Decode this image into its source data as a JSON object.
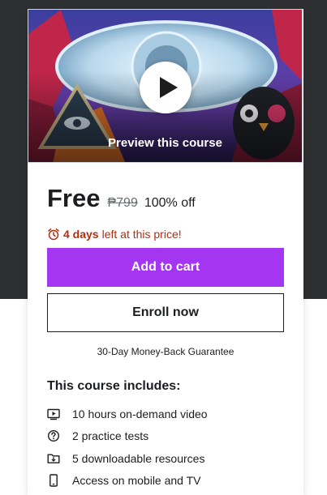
{
  "preview": {
    "label": "Preview this course",
    "play_icon": "play-icon"
  },
  "pricing": {
    "current": "Free",
    "original": "₱799",
    "discount": "100% off",
    "timer_icon": "alarm-clock-icon",
    "timer_bold": "4 days",
    "timer_rest": "left at this price!"
  },
  "actions": {
    "add_to_cart": "Add to cart",
    "enroll_now": "Enroll now"
  },
  "guarantee": "30-Day Money-Back Guarantee",
  "includes": {
    "title": "This course includes:",
    "items": [
      {
        "icon": "video-icon",
        "label": "10 hours on-demand video"
      },
      {
        "icon": "question-circle-icon",
        "label": "2 practice tests"
      },
      {
        "icon": "folder-download-icon",
        "label": "5 downloadable resources"
      },
      {
        "icon": "mobile-icon",
        "label": "Access on mobile and TV"
      }
    ]
  },
  "colors": {
    "accent": "#a435f0",
    "dark_band": "#2d2f31",
    "timer": "#b32d0f"
  }
}
